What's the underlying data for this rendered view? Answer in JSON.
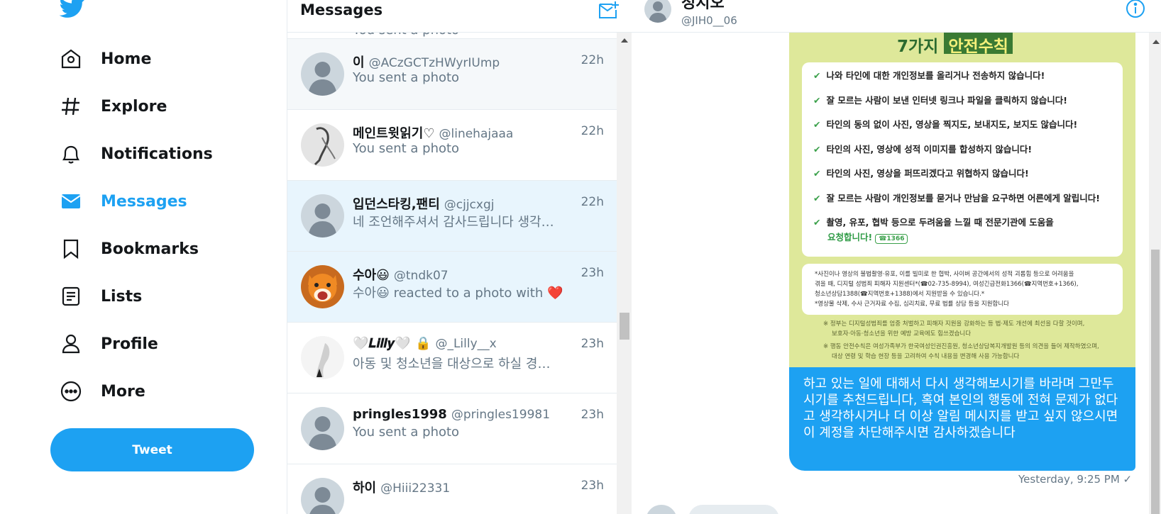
{
  "colors": {
    "accent": "#1da1f2",
    "text": "#14171a",
    "muted": "#657786",
    "heart": "#e0245e"
  },
  "nav": {
    "items": [
      {
        "label": "Home",
        "icon": "home-icon"
      },
      {
        "label": "Explore",
        "icon": "hashtag-icon"
      },
      {
        "label": "Notifications",
        "icon": "bell-icon"
      },
      {
        "label": "Messages",
        "icon": "envelope-icon",
        "active": true
      },
      {
        "label": "Bookmarks",
        "icon": "bookmark-icon"
      },
      {
        "label": "Lists",
        "icon": "list-icon"
      },
      {
        "label": "Profile",
        "icon": "person-icon"
      },
      {
        "label": "More",
        "icon": "more-icon"
      }
    ],
    "tweet_label": "Tweet"
  },
  "list": {
    "title": "Messages",
    "partial_top": {
      "preview": "You sent a photo"
    },
    "conversations": [
      {
        "name": "이",
        "handle": "@ACzGCTzHWyrIUmp",
        "time": "22h",
        "preview": "You sent a photo"
      },
      {
        "name": "메인트윗읽기♡",
        "handle": "@linehajaaa",
        "time": "22h",
        "preview": "You sent a photo"
      },
      {
        "name": "입던스타킹,팬티",
        "handle": "@cjjcxgj",
        "time": "22h",
        "preview": "네 조언해주셔서 감사드립니다 생각…"
      },
      {
        "name": "수아😃",
        "handle": "@tndk07",
        "time": "23h",
        "preview": "수아😃 reacted to a photo with ❤️"
      },
      {
        "name": "🤍𝑳𝒊𝒍𝒍𝒚🤍 🔒",
        "handle": "@_Lilly__x",
        "time": "23h",
        "preview": "아동 및 청소년을 대상으로 하실 경…"
      },
      {
        "name": "pringles1998",
        "handle": "@pringles19981",
        "time": "23h",
        "preview": "You sent a photo"
      },
      {
        "name": "하이",
        "handle": "@Hiii22331",
        "time": "23h",
        "preview": ""
      }
    ]
  },
  "chat": {
    "name": "정지오",
    "handle": "@JIH0__06",
    "poster": {
      "title_part1": "7가지",
      "title_part2": "안전수칙",
      "rules": [
        "나와 타인에 대한 개인정보를 올리거나 전송하지 않습니다!",
        "잘 모르는 사람이 보낸 인터넷 링크나 파일을 클릭하지 않습니다!",
        "타인의 동의 없이 사진, 영상을 찍지도, 보내지도, 보지도 않습니다!",
        "타인의 사진, 영상에 성적 이미지를 합성하지 않습니다!",
        "타인의 사진, 영상을 퍼뜨리겠다고 위협하지 않습니다!",
        "잘 모르는 사람이 개인정보를 묻거나 만남을 요구하면 어른에게 알립니다!",
        "촬영, 유포, 협박 등으로 두려움을 느낄 때 전문기관에 도움을"
      ],
      "rule_last_line": "요청합니다!",
      "badge": "☎1366",
      "notes": [
        "*사진이나 영상의 불법촬영·유포, 이를 빌미로 한 협박, 사이버 공간에서의 성적 괴롭힘 등으로 어려움을",
        "겪을 때, 디지털 성범죄 피해자 지원센터*(☎02-735-8994), 여성긴급전화1366(☎지역번호+1366),",
        "청소년상담1388(☎지역번호+1388)에서 지원받을 수 있습니다.*",
        "*영상물 삭제, 수사 근거자료 수집, 심리치료, 무료 법률 상담 등을 지원합니다"
      ],
      "footnotes": [
        "※ 정부는 디지털성범죄를 엄중 처벌하고 피해자 지원을 강화하는 등 법·제도 개선에 최선을 다할 것이며,",
        "보호자·아동·청소년을 위한 예방 교육에도 힘쓰겠습니다",
        "※ 행동 안전수칙은 여성가족부가 한국여성인권진흥원, 청소년상담복지개발원 등의 의견을 들어 제작하였으며,",
        "대상 연령 및 학습 현장 등을 고려하여 수칙 내용을 변경해 사용 가능합니다"
      ]
    },
    "message": "하고 있는 일에 대해서 다시 생각해보시기를 바라며 그만두시기를 추천드립니다, 혹여 본인의 행동에 전혀 문제가 없다고 생각하시거나 더 이상 알림 메시지를 받고 싶지 않으시면 이 계정을 차단해주시면 감사하겠습니다",
    "timestamp": "Yesterday, 9:25 PM ✓"
  }
}
